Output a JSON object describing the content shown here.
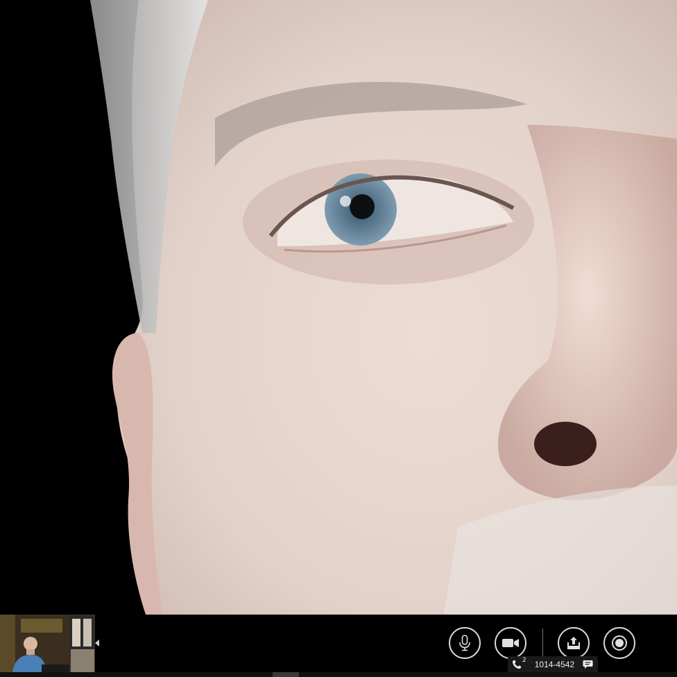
{
  "meeting": {
    "participant_count": "2",
    "meeting_id": "1014-4542"
  },
  "icons": {
    "mic": "microphone-icon",
    "video": "video-camera-icon",
    "share": "share-upload-icon",
    "record": "record-icon",
    "phone": "phone-icon",
    "chat": "chat-bubble-icon",
    "collapse": "chevron-left-icon"
  },
  "colors": {
    "background": "#000000",
    "button_outline": "#d8d8d8",
    "pill_background": "#1a1a1a",
    "skin_tone": "#e6dcd6",
    "iris": "#6e8fa8"
  }
}
